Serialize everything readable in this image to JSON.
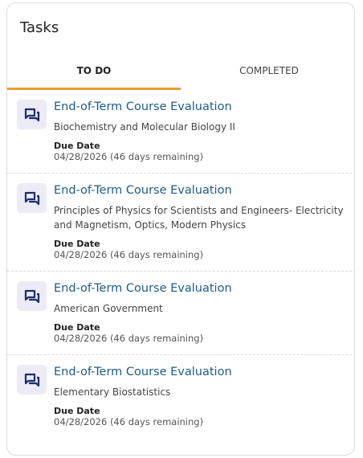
{
  "panel": {
    "title": "Tasks"
  },
  "tabs": [
    {
      "label": "TO DO",
      "active": true
    },
    {
      "label": "COMPLETED",
      "active": false
    }
  ],
  "accent_color": "#ec9b37",
  "link_color": "#1d5c8a",
  "tasks": [
    {
      "icon": "chat-icon",
      "title": "End-of-Term Course Evaluation",
      "course": "Biochemistry and Molecular Biology II",
      "due_label": "Due Date",
      "due_value": "04/28/2026 (46 days remaining)"
    },
    {
      "icon": "chat-icon",
      "title": "End-of-Term Course Evaluation",
      "course": "Principles of Physics for Scientists and Engineers- Electricity and Magnetism, Optics, Modern Physics",
      "due_label": "Due Date",
      "due_value": "04/28/2026 (46 days remaining)"
    },
    {
      "icon": "chat-icon",
      "title": "End-of-Term Course Evaluation",
      "course": "American Government",
      "due_label": "Due Date",
      "due_value": "04/28/2026 (46 days remaining)"
    },
    {
      "icon": "chat-icon",
      "title": "End-of-Term Course Evaluation",
      "course": "Elementary Biostatistics",
      "due_label": "Due Date",
      "due_value": "04/28/2026 (46 days remaining)"
    }
  ]
}
